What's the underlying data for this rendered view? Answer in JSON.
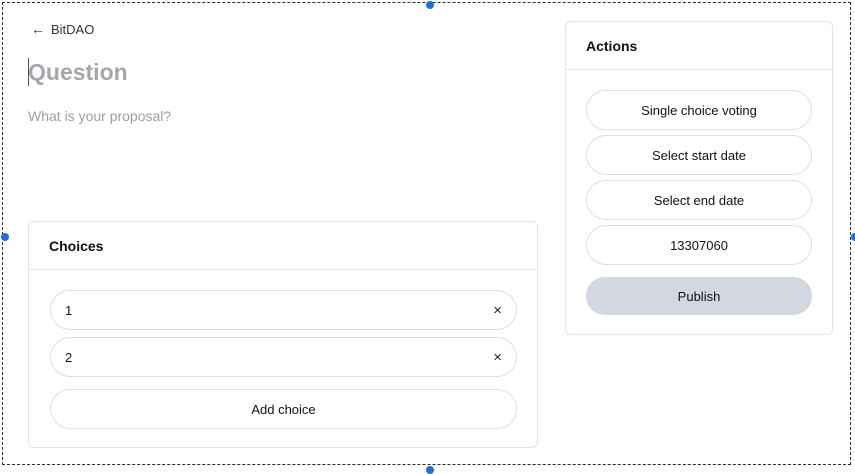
{
  "nav": {
    "back_arrow": "←",
    "back_label": "BitDAO"
  },
  "proposal": {
    "title_placeholder": "Question",
    "body_placeholder": "What is your proposal?"
  },
  "choices": {
    "header": "Choices",
    "items": [
      {
        "value": "1",
        "remove_glyph": "×"
      },
      {
        "value": "2",
        "remove_glyph": "×"
      }
    ],
    "add_label": "Add choice"
  },
  "actions": {
    "header": "Actions",
    "voting_type_label": "Single choice voting",
    "start_date_label": "Select start date",
    "end_date_label": "Select end date",
    "snapshot_block": "13307060",
    "publish_label": "Publish"
  },
  "colors": {
    "publish_bg": "#d3d8e0",
    "border": "#e2e4e8",
    "selection_handle": "#1e6fd6"
  }
}
